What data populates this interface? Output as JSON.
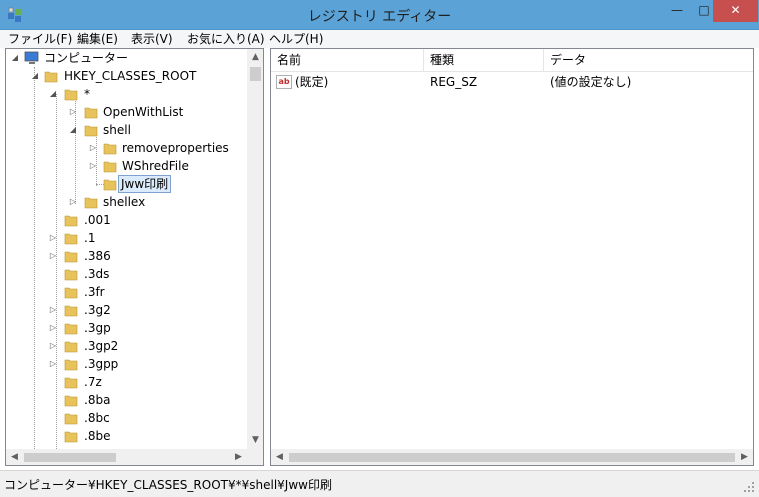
{
  "window": {
    "title": "レジストリ エディター",
    "minimize": "—",
    "maximize": "□",
    "close": "✕"
  },
  "menu": [
    {
      "label": "ファイル(F)"
    },
    {
      "label": "編集(E)"
    },
    {
      "label": "表示(V)"
    },
    {
      "label": "お気に入り(A)"
    },
    {
      "label": "ヘルプ(H)"
    }
  ],
  "tree": {
    "root": "コンピューター",
    "hive": "HKEY_CLASSES_ROOT",
    "star": "*",
    "open_with_list": "OpenWithList",
    "shell": "shell",
    "removeproperties": "removeproperties",
    "wshredfile": "WShredFile",
    "jww": "Jww印刷",
    "shellex": "shellex",
    "extensions": [
      ".001",
      ".1",
      ".386",
      ".3ds",
      ".3fr",
      ".3g2",
      ".3gp",
      ".3gp2",
      ".3gpp",
      ".7z",
      ".8ba",
      ".8bc",
      ".8be"
    ]
  },
  "list": {
    "columns": {
      "name": "名前",
      "type": "種類",
      "data": "データ"
    },
    "rows": [
      {
        "name": "(既定)",
        "type": "REG_SZ",
        "data": "(値の設定なし)",
        "icon": "ab-icon"
      }
    ]
  },
  "status": {
    "path": "コンピューター¥HKEY_CLASSES_ROOT¥*¥shell¥Jww印刷"
  },
  "colors": {
    "titlebar": "#5ba3d6",
    "close": "#c7504f",
    "folder": "#e8c25a",
    "selection": "#dcebfc"
  }
}
